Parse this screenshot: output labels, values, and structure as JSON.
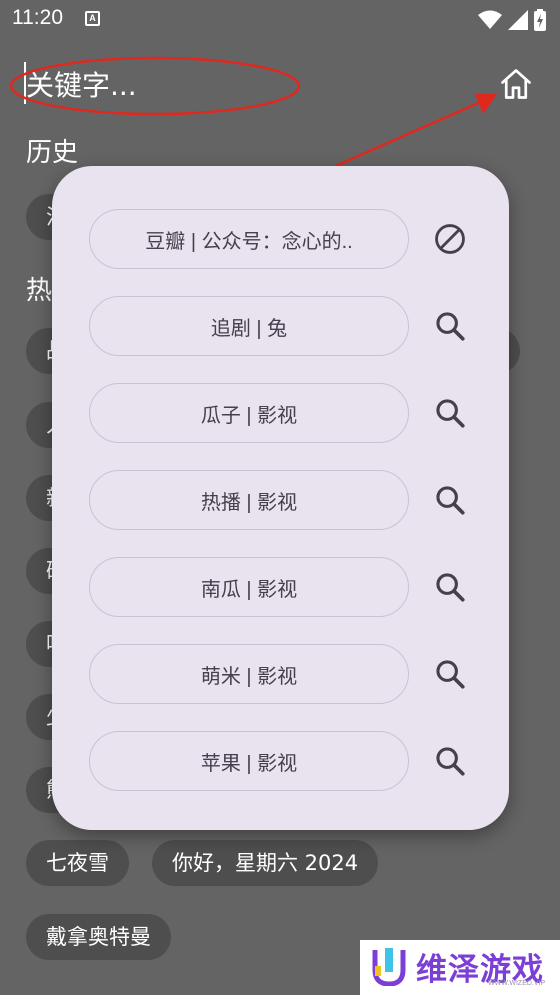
{
  "status_bar": {
    "time": "11:20",
    "notification_letter": "A"
  },
  "search": {
    "placeholder": "关键字..."
  },
  "sections": {
    "history_title": "历史",
    "hot_title_partial": "热"
  },
  "background_chips": {
    "partial_history": "混",
    "partial_rows": [
      "战",
      "人",
      "新",
      "破",
      "咱",
      "少",
      "熊"
    ],
    "row_a": [
      "七夜雪",
      "你好，星期六 2024"
    ],
    "row_b": [
      "戴拿奥特曼"
    ]
  },
  "popup": {
    "sources": [
      {
        "label": "豆瓣 | 公众号：念心的..",
        "icon": "block-icon"
      },
      {
        "label": "追剧 | 兔",
        "icon": "search-icon"
      },
      {
        "label": "瓜子 | 影视",
        "icon": "search-icon"
      },
      {
        "label": "热播 | 影视",
        "icon": "search-icon"
      },
      {
        "label": "南瓜 | 影视",
        "icon": "search-icon"
      },
      {
        "label": "萌米 | 影视",
        "icon": "search-icon"
      },
      {
        "label": "苹果 | 影视",
        "icon": "search-icon"
      }
    ]
  },
  "watermark": {
    "text": "维泽游戏",
    "sub": "WWW.WIZED.VIP"
  },
  "colors": {
    "background": "#646464",
    "popup": "#e9e3f0",
    "annotation": "#e0281e",
    "chip": "#4e4e4e",
    "icon": "#45404b"
  }
}
